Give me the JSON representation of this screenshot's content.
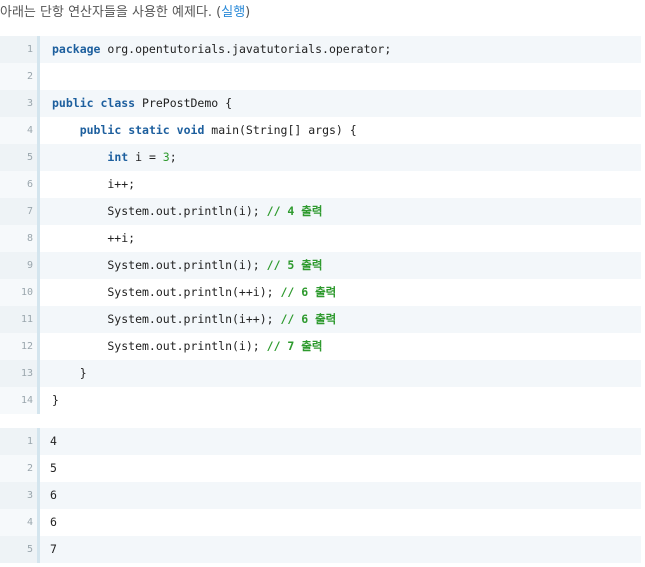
{
  "intro": {
    "text": "아래는 단항 연산자들을 사용한 예제다. (",
    "link": "실행",
    "close": ")"
  },
  "colors": {
    "keyword": "#1d5f9e",
    "comment": "#2e9a2e",
    "link": "#2a8ad8"
  },
  "code_lines": [
    {
      "num": "1",
      "tokens": [
        {
          "t": "package",
          "k": "keyword"
        },
        {
          "t": " org.opentutorials.javatutorials.operator;",
          "k": "plain"
        }
      ]
    },
    {
      "num": "2",
      "tokens": []
    },
    {
      "num": "3",
      "tokens": [
        {
          "t": "public",
          "k": "keyword"
        },
        {
          "t": " ",
          "k": "plain"
        },
        {
          "t": "class",
          "k": "keyword"
        },
        {
          "t": " PrePostDemo {",
          "k": "plain"
        }
      ]
    },
    {
      "num": "4",
      "tokens": [
        {
          "t": "    ",
          "k": "plain"
        },
        {
          "t": "public",
          "k": "keyword"
        },
        {
          "t": " ",
          "k": "plain"
        },
        {
          "t": "static",
          "k": "keyword"
        },
        {
          "t": " ",
          "k": "plain"
        },
        {
          "t": "void",
          "k": "keyword"
        },
        {
          "t": " main(String[] args) {",
          "k": "plain"
        }
      ]
    },
    {
      "num": "5",
      "tokens": [
        {
          "t": "        ",
          "k": "plain"
        },
        {
          "t": "int",
          "k": "keyword"
        },
        {
          "t": " i = ",
          "k": "plain"
        },
        {
          "t": "3",
          "k": "number"
        },
        {
          "t": ";",
          "k": "plain"
        }
      ]
    },
    {
      "num": "6",
      "tokens": [
        {
          "t": "        i++;",
          "k": "plain"
        }
      ]
    },
    {
      "num": "7",
      "tokens": [
        {
          "t": "        System.out.println(i); ",
          "k": "plain"
        },
        {
          "t": "// 4 출력",
          "k": "comment"
        }
      ]
    },
    {
      "num": "8",
      "tokens": [
        {
          "t": "        ++i;",
          "k": "plain"
        }
      ]
    },
    {
      "num": "9",
      "tokens": [
        {
          "t": "        System.out.println(i); ",
          "k": "plain"
        },
        {
          "t": "// 5 출력",
          "k": "comment"
        }
      ]
    },
    {
      "num": "10",
      "tokens": [
        {
          "t": "        System.out.println(++i); ",
          "k": "plain"
        },
        {
          "t": "// 6 출력",
          "k": "comment"
        }
      ]
    },
    {
      "num": "11",
      "tokens": [
        {
          "t": "        System.out.println(i++); ",
          "k": "plain"
        },
        {
          "t": "// 6 출력",
          "k": "comment"
        }
      ]
    },
    {
      "num": "12",
      "tokens": [
        {
          "t": "        System.out.println(i); ",
          "k": "plain"
        },
        {
          "t": "// 7 출력",
          "k": "comment"
        }
      ]
    },
    {
      "num": "13",
      "tokens": [
        {
          "t": "    }",
          "k": "plain"
        }
      ]
    },
    {
      "num": "14",
      "tokens": [
        {
          "t": "}",
          "k": "plain"
        }
      ]
    }
  ],
  "output_lines": [
    {
      "num": "1",
      "text": "4"
    },
    {
      "num": "2",
      "text": "5"
    },
    {
      "num": "3",
      "text": "6"
    },
    {
      "num": "4",
      "text": "6"
    },
    {
      "num": "5",
      "text": "7"
    }
  ]
}
